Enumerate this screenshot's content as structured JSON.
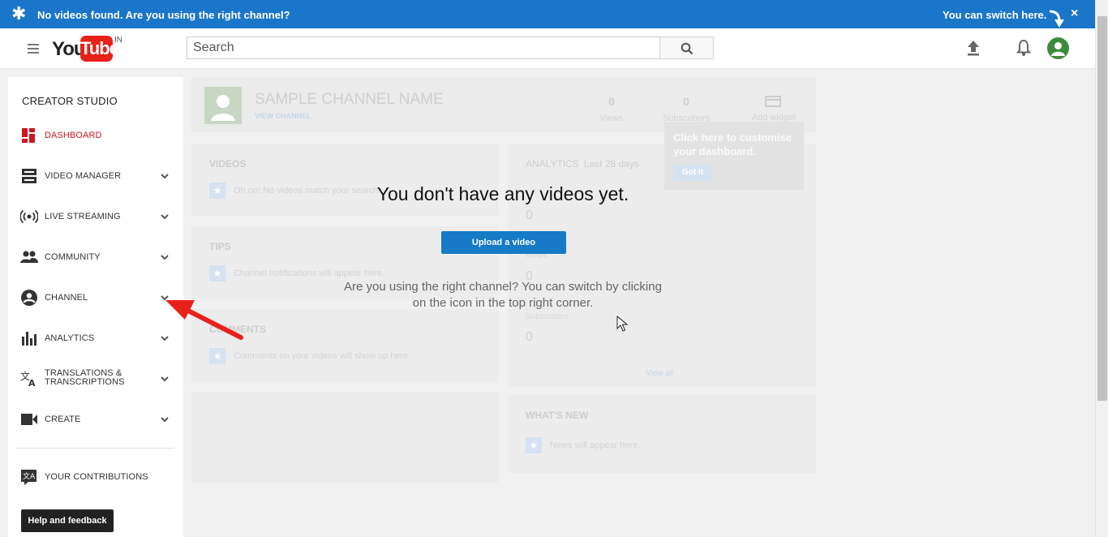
{
  "banner": {
    "message": "No videos found. Are you using the right channel?",
    "switch_text": "You can switch here.",
    "close_label": "×"
  },
  "header": {
    "logo_you": "You",
    "logo_tube": "Tube",
    "country_code": "IN",
    "search_placeholder": "Search"
  },
  "sidebar": {
    "title": "CREATOR STUDIO",
    "items": [
      {
        "label": "DASHBOARD",
        "icon": "dashboard-icon"
      },
      {
        "label": "VIDEO MANAGER",
        "icon": "video-manager-icon"
      },
      {
        "label": "LIVE STREAMING",
        "icon": "live-streaming-icon"
      },
      {
        "label": "COMMUNITY",
        "icon": "community-icon"
      },
      {
        "label": "CHANNEL",
        "icon": "channel-icon"
      },
      {
        "label": "ANALYTICS",
        "icon": "analytics-icon"
      },
      {
        "label": "TRANSLATIONS &",
        "label2": "TRANSCRIPTIONS",
        "icon": "translations-icon"
      },
      {
        "label": "CREATE",
        "icon": "create-icon"
      }
    ],
    "contributions_label": "YOUR CONTRIBUTIONS",
    "help_label": "Help and feedback"
  },
  "channel": {
    "name": "SAMPLE CHANNEL NAME",
    "view_link": "VIEW CHANNEL",
    "views_count": "0",
    "views_label": "Views",
    "subscribers_count": "0",
    "subscribers_label": "Subscribers",
    "add_widget_label": "Add widget"
  },
  "cards": {
    "videos_title": "VIDEOS",
    "videos_empty": "Oh no! No videos match your search",
    "tips_title": "TIPS",
    "tips_empty": "Channel notifications will appear here.",
    "comments_title": "COMMENTS",
    "comments_empty": "Comments on your videos will show up here.",
    "analytics_title": "ANALYTICS",
    "analytics_range": "Last 28 days",
    "analytics_val1": "0",
    "analytics_views_label": "Views",
    "analytics_val2": "0",
    "analytics_subs_label": "Subscribers",
    "analytics_val3": "0",
    "view_all": "View all",
    "whats_new_title": "WHAT'S NEW",
    "whats_new_empty": "News will appear here."
  },
  "tooltip": {
    "text": "Click here to customise your dashboard.",
    "button": "Got it"
  },
  "overlay": {
    "title": "You don't have any videos yet.",
    "upload_button": "Upload a video",
    "subtitle": "Are you using the right channel? You can switch by clicking on the icon in the top right corner."
  },
  "colors": {
    "banner": "#1a76c9",
    "brand_red": "#cc181e",
    "upload_blue": "#167ac6"
  }
}
